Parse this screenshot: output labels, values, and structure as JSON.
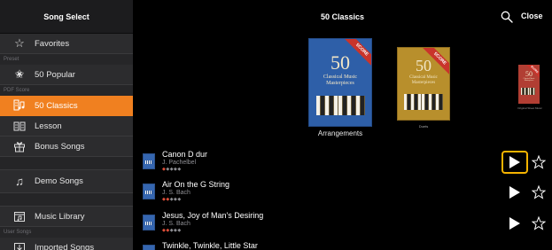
{
  "sidebar": {
    "header": "Song Select",
    "favorites_label": "Favorites",
    "section_preset": "Preset",
    "popular_label": "50 Popular",
    "section_pdf": "PDF Score",
    "classics_label": "50 Classics",
    "lesson_label": "Lesson",
    "bonus_label": "Bonus Songs",
    "demo_label": "Demo Songs",
    "music_library_label": "Music Library",
    "section_user": "User Songs",
    "imported_label": "Imported Songs"
  },
  "header": {
    "title": "50 Classics",
    "close_label": "Close"
  },
  "books": {
    "blue": {
      "score_tag": "SCORE",
      "number": "50",
      "subtitle": "Classical Music Masterpieces"
    },
    "gold": {
      "score_tag": "SCORE",
      "number": "50",
      "subtitle": "Classical Music Masterpieces",
      "caption": "Duets"
    },
    "red": {
      "score_tag": "SCORE",
      "number": "50",
      "subtitle": "Classical Music Masterpieces",
      "caption": "Original Sheet Music"
    },
    "selected_label": "Arrangements"
  },
  "songs": [
    {
      "title": "Canon D dur",
      "composer": "J. Pachelbel",
      "difficulty": "◆◆◆◆◆"
    },
    {
      "title": "Air On the G String",
      "composer": "J. S. Bach",
      "difficulty": "◆◆◆◆◆"
    },
    {
      "title": "Jesus, Joy of Man's Desiring",
      "composer": "J. S. Bach",
      "difficulty": "◆◆◆◆◆"
    },
    {
      "title": "Twinkle, Twinkle, Little Star",
      "composer": "",
      "difficulty": ""
    }
  ],
  "colors": {
    "accent": "#f08020",
    "focus_highlight": "#f5b300",
    "difficulty_filled": "#e0503a",
    "difficulty_empty": "#8e8e93"
  },
  "icons": {
    "favorites": "star-outline-icon",
    "popular": "star-shield-icon",
    "classics": "score-icon",
    "lesson": "lesson-book-icon",
    "bonus": "gift-icon",
    "demo": "music-notes-icon",
    "music_library": "music-library-icon",
    "imported": "import-icon",
    "search": "search-icon",
    "play": "play-icon",
    "favorite_toggle": "star-outline-icon"
  }
}
